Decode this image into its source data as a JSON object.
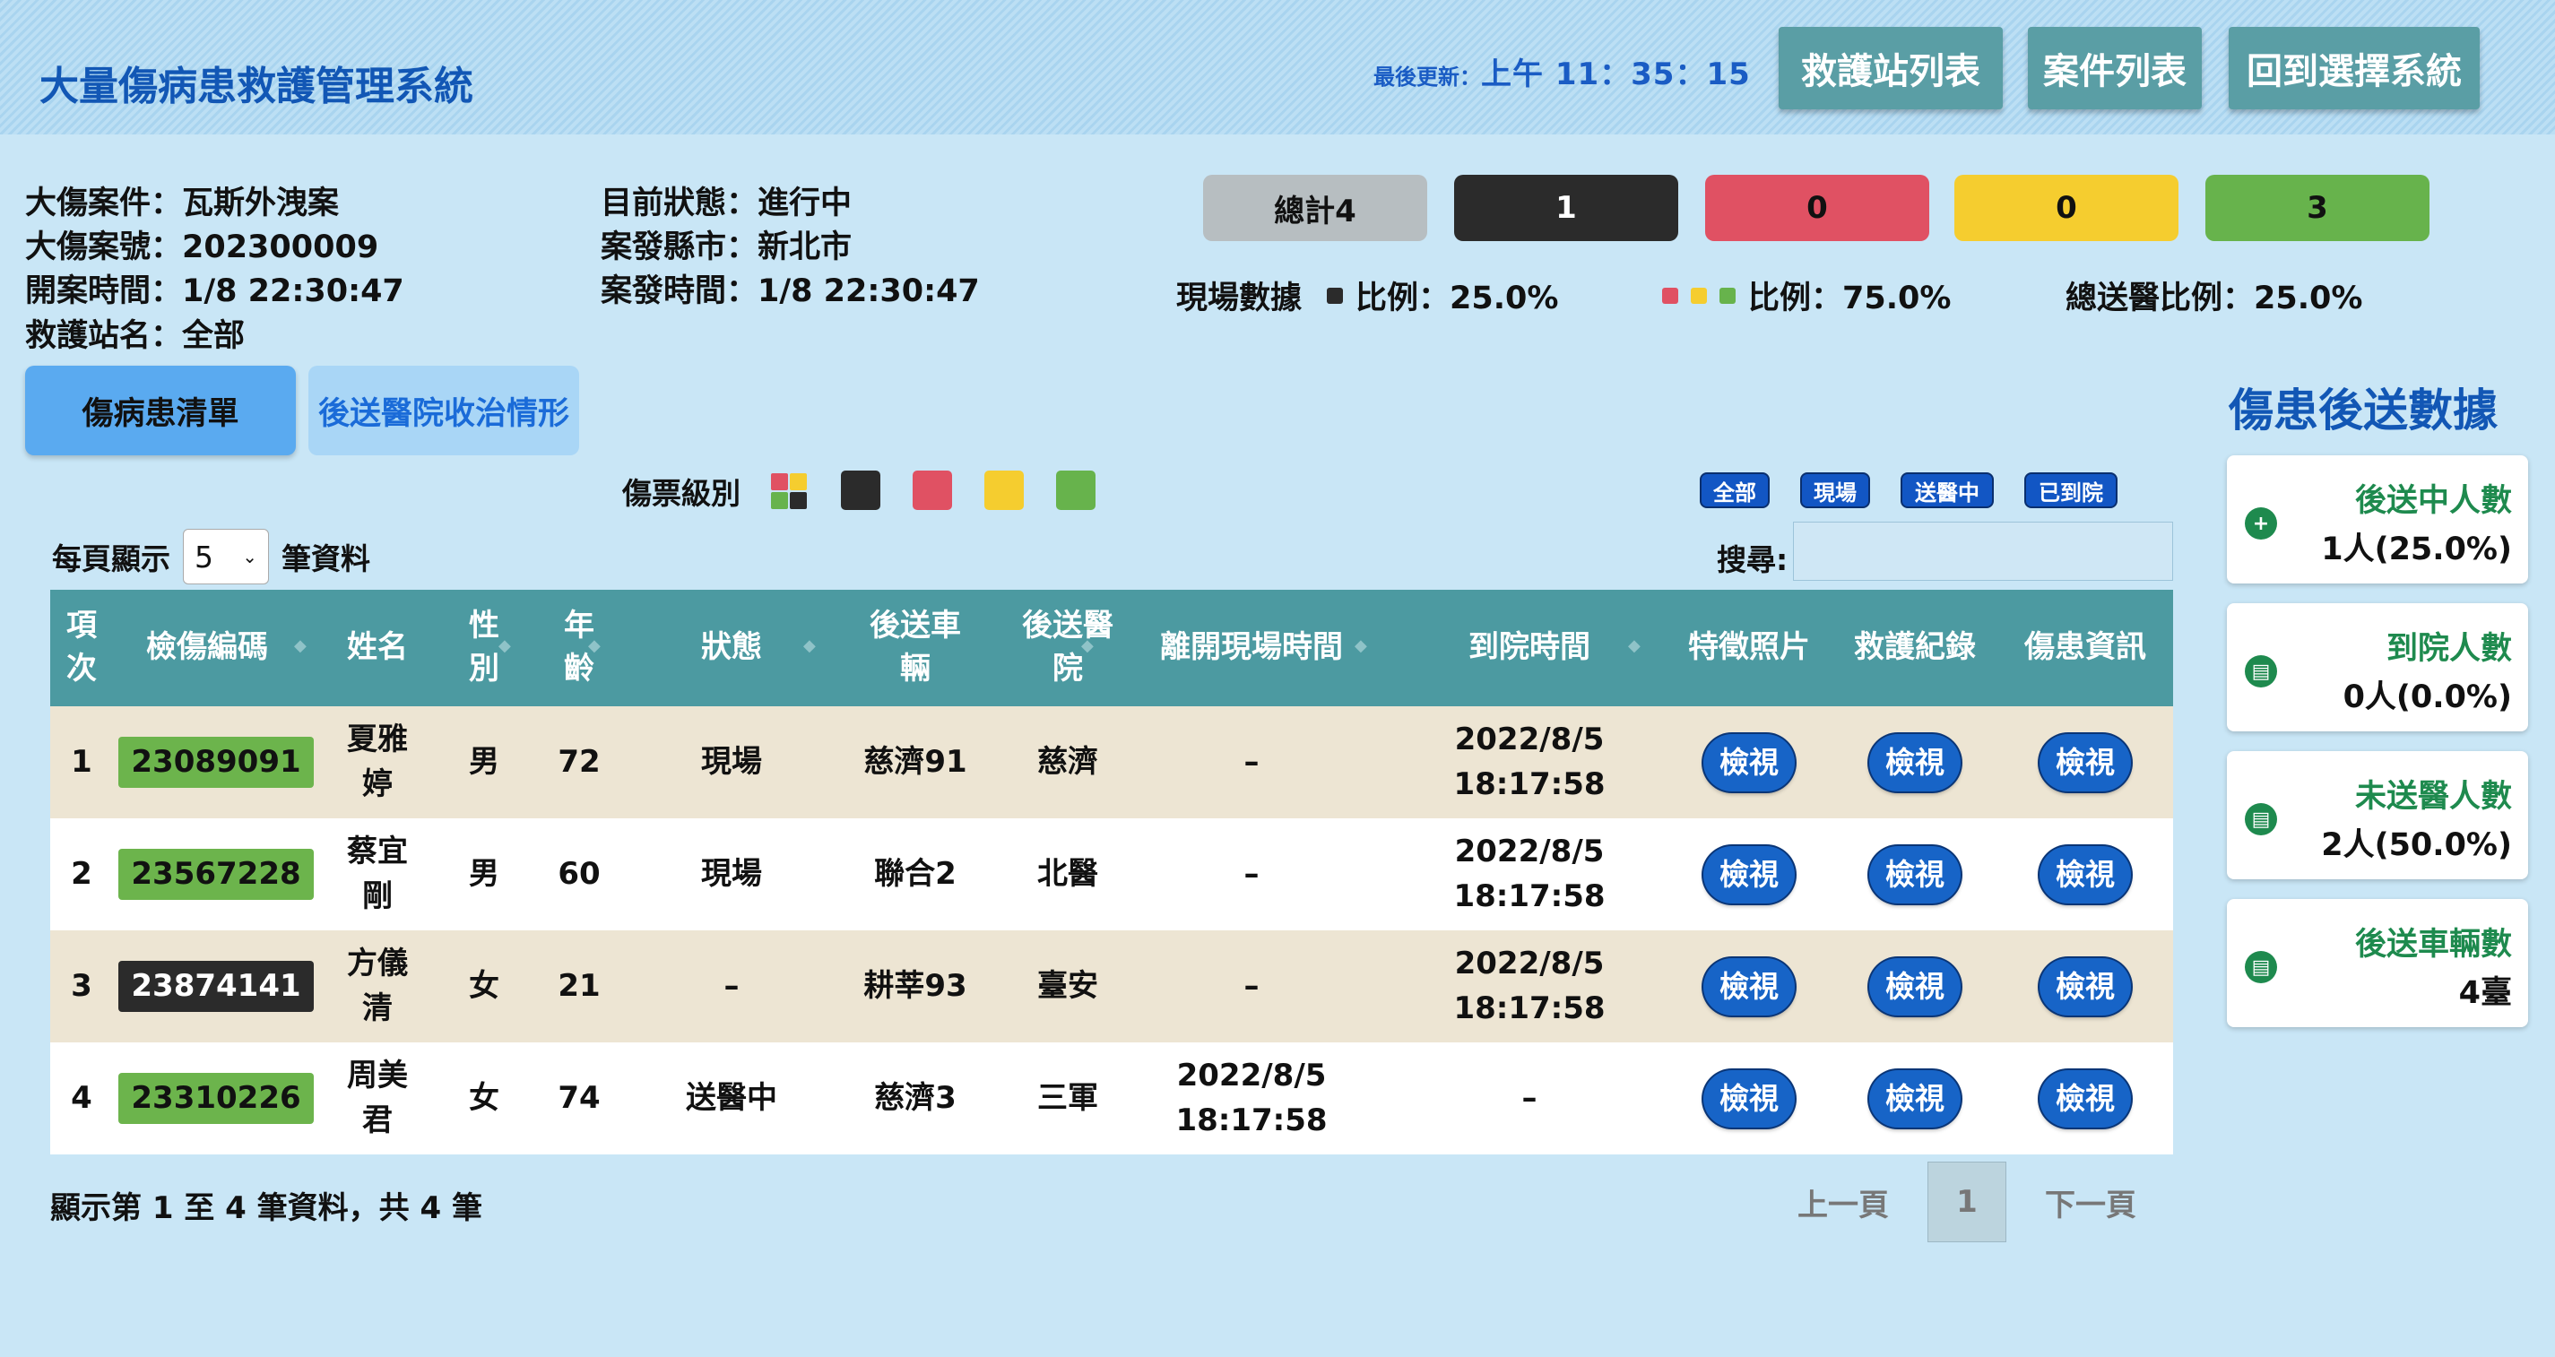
{
  "header": {
    "title": "大量傷病患救護管理系統",
    "last_update_label": "最後更新：",
    "last_update_value": "上午 11：35：15",
    "buttons": [
      "救護站列表",
      "案件列表",
      "回到選擇系統"
    ]
  },
  "case_info": {
    "name": "大傷案件：瓦斯外洩案",
    "number": "大傷案號：202300009",
    "open_time": "開案時間：1/8 22:30:47",
    "station": "救護站名：全部",
    "status": "目前狀態：進行中",
    "city": "案發縣市：新北市",
    "incident_time": "案發時間：1/8 22:30:47"
  },
  "counts": {
    "total": "總計4",
    "black": "1",
    "red": "0",
    "yellow": "0",
    "green": "3"
  },
  "stats": {
    "onsite_label": "現場數據",
    "black_ratio": "比例：25.0%",
    "other_ratio": "比例：75.0%",
    "hospital_ratio": "總送醫比例：25.0%"
  },
  "colors": {
    "black": "#2b2b2b",
    "red": "#e05163",
    "yellow": "#f5cd2f",
    "green": "#67b34c",
    "gray": "#b7bec1",
    "accent": "#1257b5"
  },
  "tabs": {
    "patients": "傷病患清單",
    "hospital": "後送醫院收治情形"
  },
  "filters": {
    "triage_label": "傷票級別",
    "status_pills": [
      "全部",
      "現場",
      "送醫中",
      "已到院"
    ]
  },
  "table_controls": {
    "per_page_prefix": "每頁顯示",
    "per_page_value": "5",
    "per_page_suffix": "筆資料",
    "search_label": "搜尋:"
  },
  "table": {
    "headers": [
      "項次",
      "檢傷編碼",
      "姓名",
      "性別",
      "年齡",
      "狀態",
      "後送車輛",
      "後送醫院",
      "離開現場時間",
      "到院時間",
      "特徵照片",
      "救護紀錄",
      "傷患資訊"
    ],
    "view_label": "檢視",
    "rows": [
      {
        "idx": "1",
        "code": "23089091",
        "code_color": "green",
        "name": "夏雅婷",
        "sex": "男",
        "age": "72",
        "status": "現場",
        "vehicle": "慈濟91",
        "hospital": "慈濟",
        "leave": "–",
        "arrive": "2022/8/5 18:17:58"
      },
      {
        "idx": "2",
        "code": "23567228",
        "code_color": "green",
        "name": "蔡宜剛",
        "sex": "男",
        "age": "60",
        "status": "現場",
        "vehicle": "聯合2",
        "hospital": "北醫",
        "leave": "–",
        "arrive": "2022/8/5 18:17:58"
      },
      {
        "idx": "3",
        "code": "23874141",
        "code_color": "black",
        "name": "方儀清",
        "sex": "女",
        "age": "21",
        "status": "–",
        "vehicle": "耕莘93",
        "hospital": "臺安",
        "leave": "–",
        "arrive": "2022/8/5 18:17:58"
      },
      {
        "idx": "4",
        "code": "23310226",
        "code_color": "green",
        "name": "周美君",
        "sex": "女",
        "age": "74",
        "status": "送醫中",
        "vehicle": "慈濟3",
        "hospital": "三軍",
        "leave": "2022/8/5 18:17:58",
        "arrive": "–"
      }
    ]
  },
  "pagination": {
    "info": "顯示第 1 至 4 筆資料，共 4 筆",
    "prev": "上一頁",
    "current": "1",
    "next": "下一頁"
  },
  "sidebar": {
    "title": "傷患後送數據",
    "cards": [
      {
        "label": "後送中人數",
        "value": "1人(25.0%)",
        "icon": "plus-circle-icon"
      },
      {
        "label": "到院人數",
        "value": "0人(0.0%)",
        "icon": "bed-icon"
      },
      {
        "label": "未送醫人數",
        "value": "2人(50.0%)",
        "icon": "bed-icon"
      },
      {
        "label": "後送車輛數",
        "value": "4臺",
        "icon": "bed-icon"
      }
    ]
  }
}
